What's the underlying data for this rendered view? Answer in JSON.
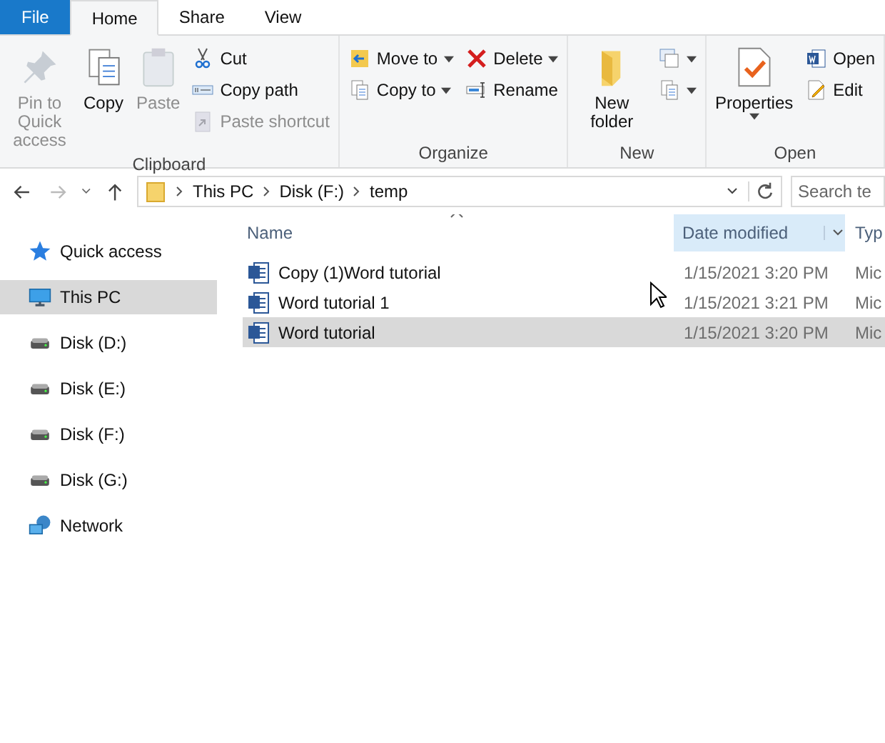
{
  "ribbon_tabs": [
    {
      "label": "File",
      "kind": "file",
      "selected": false
    },
    {
      "label": "Home",
      "kind": "tab",
      "selected": true
    },
    {
      "label": "Share",
      "kind": "tab",
      "selected": false
    },
    {
      "label": "View",
      "kind": "tab",
      "selected": false
    }
  ],
  "ribbon_groups": [
    {
      "label": "Clipboard",
      "columns": [
        {
          "kind": "large",
          "buttons": [
            {
              "label": "Pin to Quick access",
              "kind": "pin",
              "disabled": true,
              "dropdown": false
            }
          ]
        },
        {
          "kind": "large",
          "buttons": [
            {
              "label": "Copy",
              "kind": "copy",
              "disabled": false,
              "dropdown": false
            }
          ]
        },
        {
          "kind": "large",
          "buttons": [
            {
              "label": "Paste",
              "kind": "paste",
              "disabled": true,
              "dropdown": false
            }
          ]
        },
        {
          "kind": "small",
          "buttons": [
            {
              "label": "Cut",
              "kind": "scissors",
              "disabled": false,
              "dropdown": false
            },
            {
              "label": "Copy path",
              "kind": "path",
              "disabled": false,
              "dropdown": false
            },
            {
              "label": "Paste shortcut",
              "kind": "shortcut",
              "disabled": true,
              "dropdown": false
            }
          ]
        }
      ]
    },
    {
      "label": "Organize",
      "columns": [
        {
          "kind": "small",
          "buttons": [
            {
              "label": "Move to",
              "kind": "move",
              "disabled": false,
              "dropdown": true
            },
            {
              "label": "Copy to",
              "kind": "copyto",
              "disabled": false,
              "dropdown": true
            }
          ]
        },
        {
          "kind": "small",
          "buttons": [
            {
              "label": "Delete",
              "kind": "delete",
              "disabled": false,
              "dropdown": true
            },
            {
              "label": "Rename",
              "kind": "rename",
              "disabled": false,
              "dropdown": false
            }
          ]
        }
      ]
    },
    {
      "label": "New",
      "columns": [
        {
          "kind": "large",
          "buttons": [
            {
              "label": "New folder",
              "kind": "folder",
              "disabled": false,
              "dropdown": false
            }
          ]
        },
        {
          "kind": "small",
          "buttons": [
            {
              "kind": "newitem",
              "disabled": false,
              "dropdown": true
            },
            {
              "kind": "easy",
              "disabled": false,
              "dropdown": true
            }
          ]
        }
      ]
    },
    {
      "label": "Open",
      "columns": [
        {
          "kind": "large",
          "buttons": [
            {
              "label": "Properties",
              "kind": "properties",
              "disabled": false,
              "dropdown": true
            }
          ]
        },
        {
          "kind": "small",
          "buttons": [
            {
              "label": "Open",
              "kind": "word",
              "disabled": false,
              "dropdown": false
            },
            {
              "label": "Edit",
              "kind": "edit",
              "disabled": false,
              "dropdown": false
            }
          ]
        }
      ]
    }
  ],
  "nav": {
    "back_disabled": false,
    "forward_disabled": true,
    "breadcrumbs": [
      "This PC",
      "Disk (F:)",
      "temp"
    ],
    "search": {
      "placeholder": "Search te"
    }
  },
  "sidebar": {
    "items": [
      {
        "label": "Quick access",
        "kind": "star",
        "selected": false
      },
      {
        "label": "This PC",
        "kind": "pc",
        "selected": true
      },
      {
        "label": "Disk (D:)",
        "kind": "disk",
        "selected": false
      },
      {
        "label": "Disk (E:)",
        "kind": "disk",
        "selected": false
      },
      {
        "label": "Disk (F:)",
        "kind": "disk",
        "selected": false
      },
      {
        "label": "Disk (G:)",
        "kind": "disk",
        "selected": false
      },
      {
        "label": "Network",
        "kind": "network",
        "selected": false
      }
    ]
  },
  "file_list": {
    "columns": [
      {
        "label": "Name",
        "sorted": true,
        "hovered": false
      },
      {
        "label": "Date modified",
        "sorted": false,
        "hovered": true
      },
      {
        "label": "Typ",
        "sorted": false,
        "hovered": false
      }
    ],
    "rows": [
      {
        "name": "Copy (1)Word tutorial",
        "date": "1/15/2021 3:20 PM",
        "column_3": "Mic",
        "selected": false
      },
      {
        "name": "Word tutorial 1",
        "date": "1/15/2021 3:21 PM",
        "column_3": "Mic",
        "selected": false
      },
      {
        "name": "Word tutorial",
        "date": "1/15/2021 3:20 PM",
        "column_3": "Mic",
        "selected": true
      }
    ]
  }
}
